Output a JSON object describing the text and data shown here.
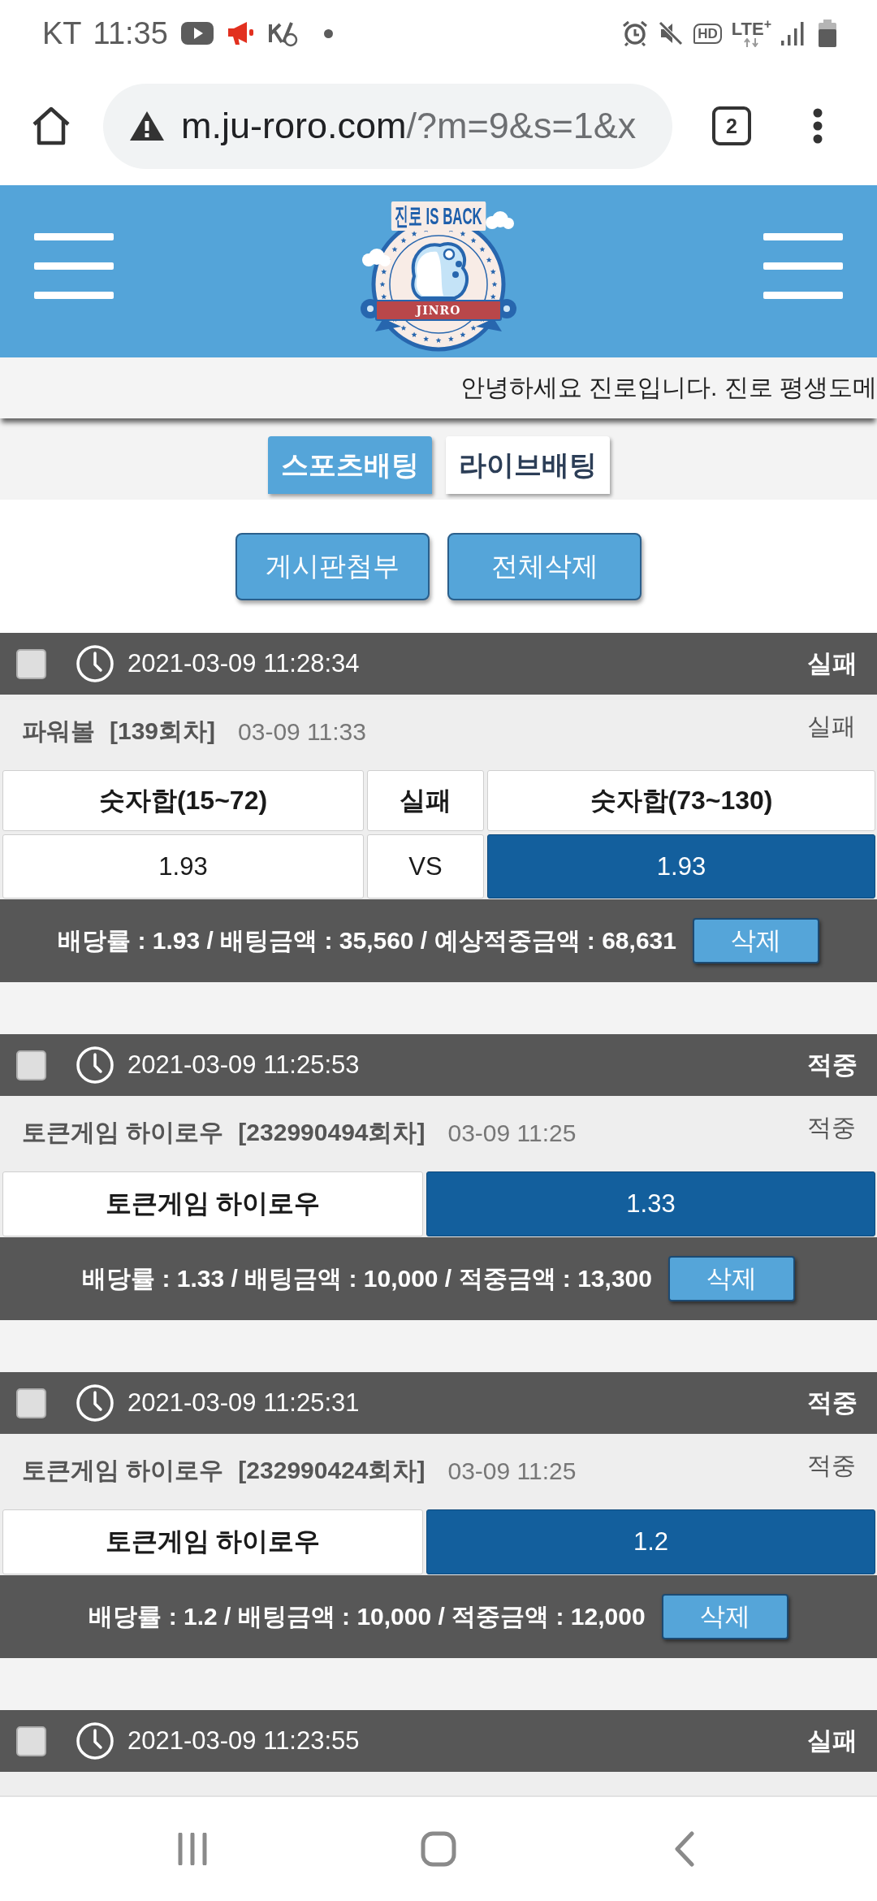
{
  "status_bar": {
    "carrier": "KT",
    "time": "11:35",
    "hd": "HD",
    "network": "LTE$^{+}$"
  },
  "browser": {
    "host": "m.ju-roro.com",
    "path": "/?m=9&s=1&x",
    "tab_count": "2"
  },
  "header": {
    "logo_title": "진로 IS BACK",
    "logo_banner": "JINRO"
  },
  "notice": "안녕하세요 진로입니다. 진로 평생도메",
  "tabs": [
    {
      "label": "스포츠배팅",
      "selected": true
    },
    {
      "label": "라이브배팅",
      "selected": false
    }
  ],
  "actions": [
    "게시판첨부",
    "전체삭제"
  ],
  "bets": [
    {
      "checked": false,
      "placed_at": "2021-03-09 11:28:34",
      "status": "실패",
      "game": "파워볼",
      "round": "[139회차]",
      "time": "03-09 11:33",
      "result": "실패",
      "kind": "three_way",
      "picks": [
        {
          "label": "숫자합(15~72)",
          "odds": "1.93",
          "selected": false
        },
        {
          "label": "실패",
          "odds": "VS",
          "selected": false
        },
        {
          "label": "숫자합(73~130)",
          "odds": "1.93",
          "selected": true
        }
      ],
      "summary": "배당률 : 1.93 / 배팅금액 : 35,560 / 예상적중금액 : 68,631",
      "delete": "삭제"
    },
    {
      "checked": false,
      "placed_at": "2021-03-09 11:25:53",
      "status": "적중",
      "game": "토큰게임 하이로우",
      "round": "[232990494회차]",
      "time": "03-09 11:25",
      "result": "적중",
      "kind": "single",
      "picks": [
        {
          "label": "토큰게임 하이로우",
          "odds": "1.33",
          "selected": true
        }
      ],
      "summary": "배당률 : 1.33 / 배팅금액 : 10,000 / 적중금액 : 13,300",
      "delete": "삭제"
    },
    {
      "checked": false,
      "placed_at": "2021-03-09 11:25:31",
      "status": "적중",
      "game": "토큰게임 하이로우",
      "round": "[232990424회차]",
      "time": "03-09 11:25",
      "result": "적중",
      "kind": "single",
      "picks": [
        {
          "label": "토큰게임 하이로우",
          "odds": "1.2",
          "selected": true
        }
      ],
      "summary": "배당률 : 1.2 / 배팅금액 : 10,000 / 적중금액 : 12,000",
      "delete": "삭제"
    },
    {
      "checked": false,
      "placed_at": "2021-03-09 11:23:55",
      "status": "실패"
    }
  ]
}
